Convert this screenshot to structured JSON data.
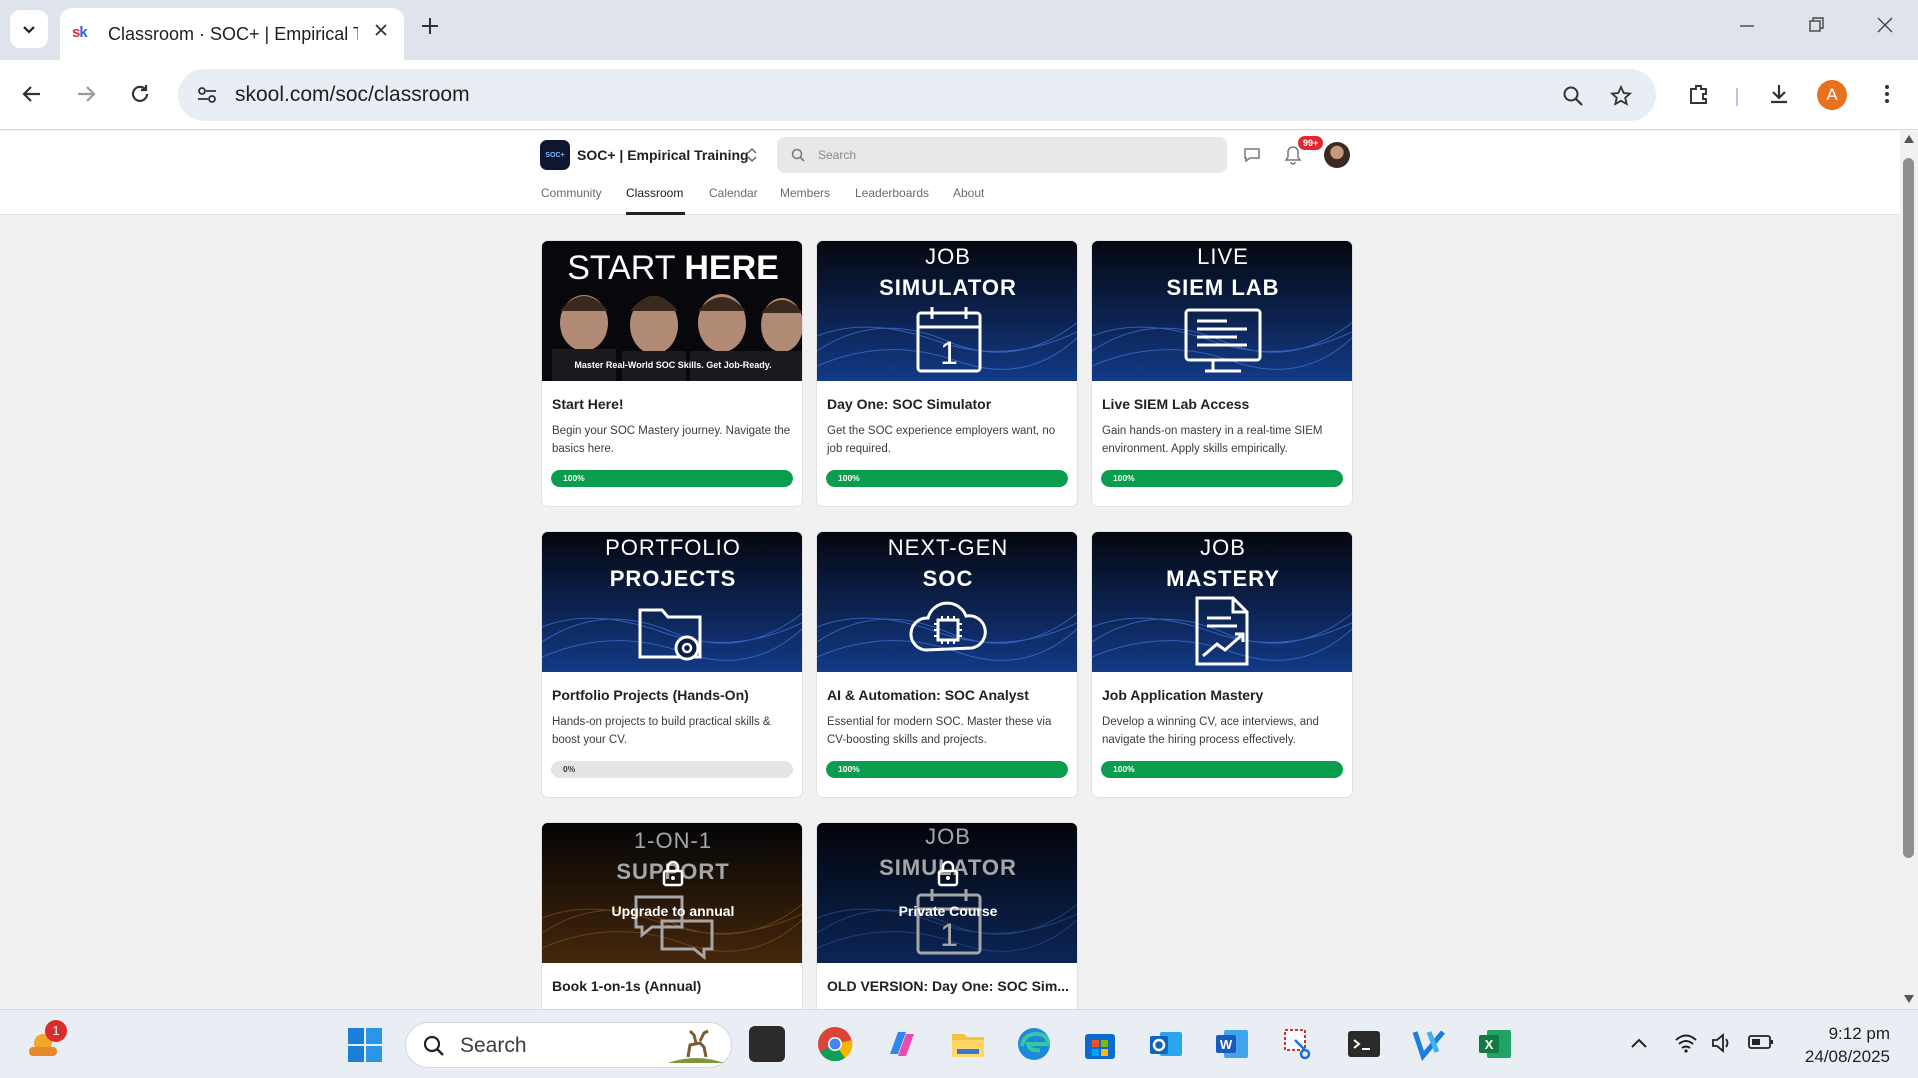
{
  "browser": {
    "tab_title": "Classroom · SOC+ | Empirical Tr",
    "url": "skool.com/soc/classroom",
    "profile_initial": "A"
  },
  "site": {
    "group_name": "SOC+ | Empirical Training",
    "logo_text": "SOC+",
    "search_placeholder": "Search",
    "notification_count": "99+",
    "tabs": [
      "Community",
      "Classroom",
      "Calendar",
      "Members",
      "Leaderboards",
      "About"
    ],
    "active_tab": "Classroom"
  },
  "courses": [
    {
      "thumb_line1": "START",
      "thumb_line2": "HERE",
      "thumb_caption": "Master Real-World SOC Skills. Get Job-Ready.",
      "title": "Start Here!",
      "description": "Begin your SOC Mastery journey. Navigate the basics here.",
      "progress_label": "100%",
      "progress": 100,
      "icon": "people-photo"
    },
    {
      "thumb_line1": "JOB",
      "thumb_line2": "SIMULATOR",
      "title": "Day One: SOC Simulator",
      "description": "Get the SOC experience employers want, no job required.",
      "progress_label": "100%",
      "progress": 100,
      "icon": "calendar-icon",
      "icon_text": "1"
    },
    {
      "thumb_line1": "LIVE",
      "thumb_line2": "SIEM LAB",
      "title": "Live SIEM Lab Access",
      "description": "Gain hands-on mastery in a real-time SIEM environment. Apply skills empirically.",
      "progress_label": "100%",
      "progress": 100,
      "icon": "monitor-icon"
    },
    {
      "thumb_line1": "PORTFOLIO",
      "thumb_line2": "PROJECTS",
      "title": "Portfolio Projects (Hands-On)",
      "description": "Hands-on projects to build practical skills & boost your CV.",
      "progress_label": "0%",
      "progress": 0,
      "icon": "folder-gear-icon"
    },
    {
      "thumb_line1": "NEXT-GEN",
      "thumb_line2": "SOC",
      "title": "AI & Automation: SOC Analyst",
      "description": "Essential for modern SOC. Master these via CV-boosting skills and projects.",
      "progress_label": "100%",
      "progress": 100,
      "icon": "cloud-chip-icon"
    },
    {
      "thumb_line1": "JOB",
      "thumb_line2": "MASTERY",
      "title": "Job Application Mastery",
      "description": "Develop a winning CV, ace interviews, and navigate the hiring process effectively.",
      "progress_label": "100%",
      "progress": 100,
      "icon": "document-chart-icon"
    },
    {
      "thumb_line1": "1-ON-1",
      "thumb_line2": "SUPPORT",
      "title": "Book 1-on-1s (Annual)",
      "locked_label": "Upgrade to annual",
      "icon": "chat-bubbles-icon"
    },
    {
      "thumb_line1": "JOB",
      "thumb_line2": "SIMULATOR",
      "title": "OLD VERSION: Day One: SOC Sim...",
      "locked_label": "Private Course",
      "icon": "calendar-icon",
      "icon_text": "1"
    }
  ],
  "taskbar": {
    "search_placeholder": "Search",
    "weather_badge": "1",
    "time": "9:12 pm",
    "date": "24/08/2025"
  },
  "colors": {
    "progress": "#0a9d4e",
    "badge": "#e0282f",
    "profile": "#e8711d"
  }
}
